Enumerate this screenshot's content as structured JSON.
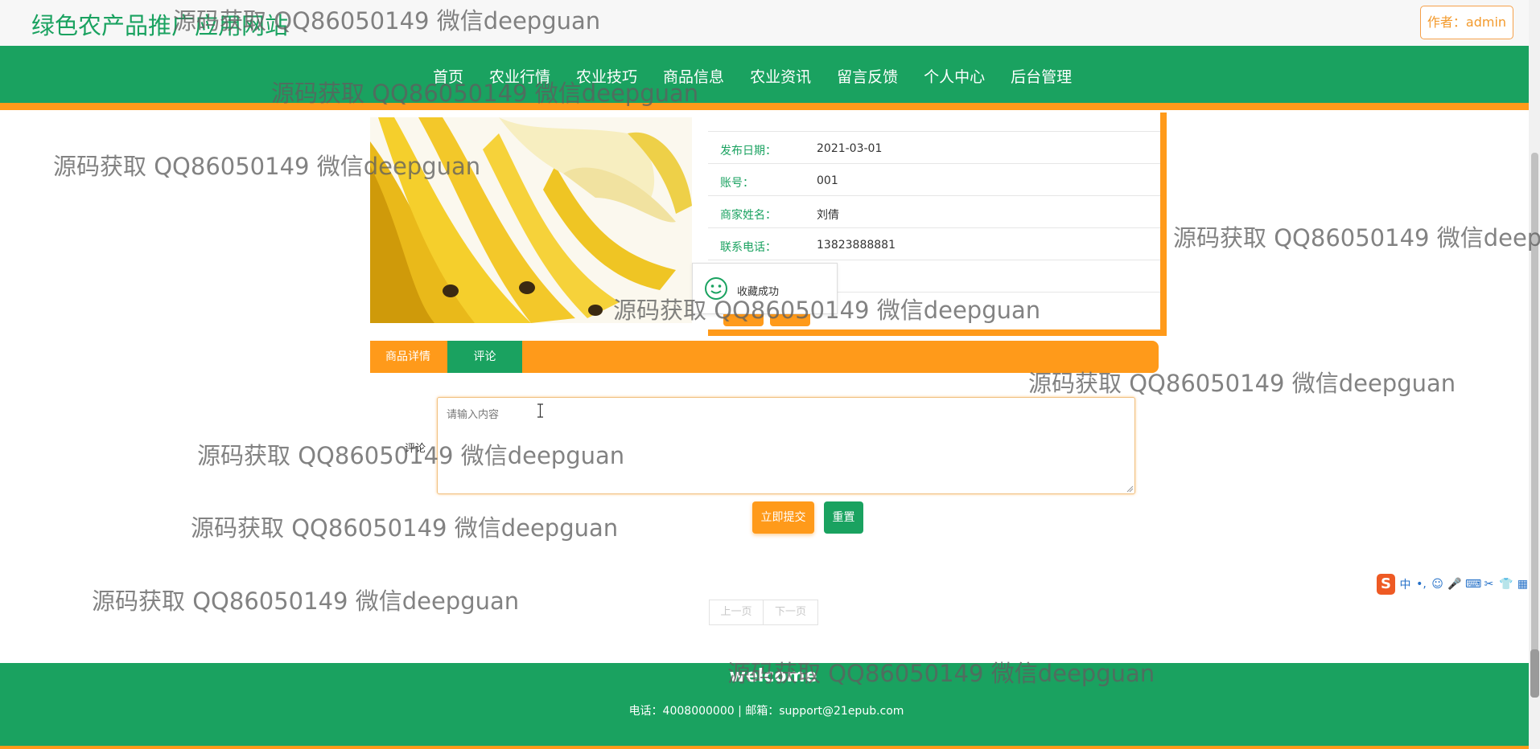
{
  "header": {
    "site_title": "绿色农产品推广应用网站",
    "author_badge": "作者：admin"
  },
  "nav": {
    "items": [
      "首页",
      "农业行情",
      "农业技巧",
      "商品信息",
      "农业资讯",
      "留言反馈",
      "个人中心",
      "后台管理"
    ]
  },
  "product": {
    "image_icon": "banana-photo",
    "fields": [
      {
        "label": "发布日期：",
        "value": "2021-03-01"
      },
      {
        "label": "账号：",
        "value": "001"
      },
      {
        "label": "商家姓名：",
        "value": "刘倩"
      },
      {
        "label": "联系电话：",
        "value": "13823888881"
      }
    ]
  },
  "toast": {
    "icon": "smile-icon",
    "text": "收藏成功"
  },
  "tabs": [
    {
      "label": "商品详情"
    },
    {
      "label": "评论"
    }
  ],
  "comment_form": {
    "label": "评论",
    "placeholder": "请输入内容",
    "value": "",
    "submit_label": "立即提交",
    "reset_label": "重置"
  },
  "pagination": {
    "prev_label": "上一页",
    "next_label": "下一页"
  },
  "footer": {
    "welcome": "welcome",
    "contact": "电话：4008000000 | 邮箱：support@21epub.com"
  },
  "ime": {
    "logo": "S",
    "keys": [
      "中",
      "•,",
      "☺",
      "🎤",
      "⌨",
      "✂",
      "👕",
      "▦"
    ]
  },
  "watermark": {
    "text": "源码获取 QQ86050149 微信deepguan"
  },
  "colors": {
    "primary_green": "#1aa260",
    "accent_orange": "#ff9a1a"
  }
}
